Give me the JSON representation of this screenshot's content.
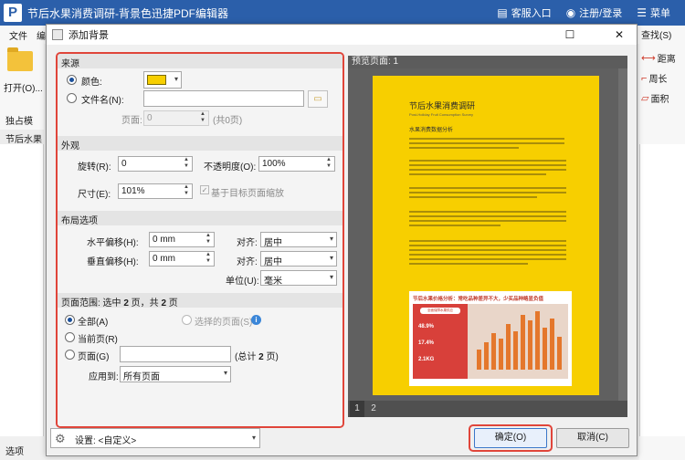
{
  "app": {
    "title": "节后水果消费调研-背景色迅捷PDF编辑器",
    "logo_letter": "P",
    "customer_service": "客服入口",
    "login": "注册/登录",
    "menu": "菜单",
    "menubar": [
      "文件",
      "编"
    ],
    "open_label": "打开(O)...",
    "row2_label": "独占模",
    "doc_tab": "节后水果",
    "bottom_left": "选项",
    "right_search": "查找(S)",
    "right_items": [
      "距离",
      "周长",
      "面积"
    ]
  },
  "dialog": {
    "title": "添加背景",
    "source": {
      "header": "来源",
      "color_label": "颜色:",
      "color_value": "#f7cf00",
      "file_label": "文件名(N):",
      "file_value": "",
      "page_label": "页面:",
      "page_value": "0",
      "page_total": "(共0页)"
    },
    "appearance": {
      "header": "外观",
      "rotate_label": "旋转(R):",
      "rotate_value": "0",
      "opacity_label": "不透明度(O):",
      "opacity_value": "100%",
      "size_label": "尺寸(E):",
      "size_value": "101%",
      "scale_check_label": "基于目标页面缩放"
    },
    "layout": {
      "header": "布局选项",
      "h_offset_label": "水平偏移(H):",
      "h_offset_value": "0 mm",
      "v_offset_label": "垂直偏移(H):",
      "v_offset_value": "0 mm",
      "align_label": "对齐:",
      "h_align_value": "居中",
      "v_align_value": "居中",
      "unit_label": "单位(U):",
      "unit_value": "毫米"
    },
    "range": {
      "header_prefix": "页面范围: 选中 ",
      "selected_count": "2",
      "header_mid": " 页，共 ",
      "total_count": "2",
      "header_suffix": " 页",
      "all_label": "全部(A)",
      "selected_pages_label": "选择的页面(S)",
      "current_label": "当前页(R)",
      "pages_label": "页面(G)",
      "pages_value": "",
      "pages_total_prefix": "(总计 ",
      "pages_total": "2",
      "pages_total_suffix": " 页)",
      "apply_label": "应用到:",
      "apply_value": "所有页面"
    },
    "preview": {
      "header": "预览页面: 1",
      "pages": [
        "1",
        "2"
      ],
      "doc_title": "节后水果消费调研",
      "doc_subtitle": "Post-Holiday Fruit Consumption Survey",
      "doc_section": "水果消费数据分析",
      "chart_title": "节后水果价格分析：常吃品种差异不大，少买品种略显负值",
      "chart_pill": "全面保障水果供应",
      "chart_stats": [
        "48.9%",
        "17.4%",
        "2.1KG"
      ]
    },
    "settings_label": "设置: <自定义>",
    "ok_label": "确定(O)",
    "cancel_label": "取消(C)"
  }
}
